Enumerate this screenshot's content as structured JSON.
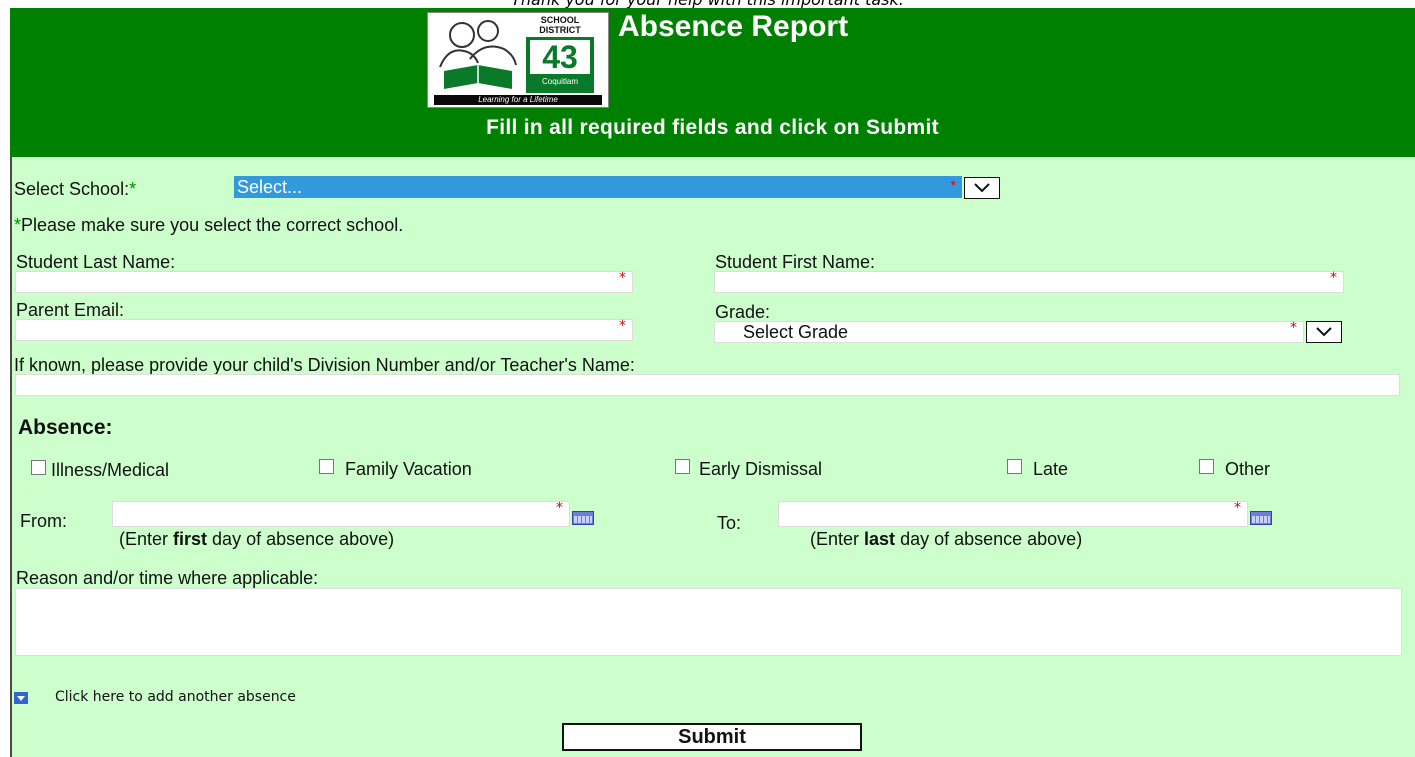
{
  "top_text": "Thank you for your help with this important task.",
  "header": {
    "title": "Absence Report",
    "subtitle": "Fill in all required fields and click on Submit",
    "logo": {
      "school_line1": "SCHOOL",
      "school_line2": "DISTRICT",
      "number": "43",
      "city": "Coquitlam",
      "tagline": "Learning for a Lifetime"
    }
  },
  "form": {
    "select_school_label": "Select School:",
    "required_mark": "*",
    "select_school_value": "Select...",
    "school_note": "Please make sure you select the correct school.",
    "last_name_label": "Student Last Name:",
    "first_name_label": "Student First Name:",
    "parent_email_label": "Parent Email:",
    "grade_label": "Grade:",
    "grade_value": "Select Grade",
    "division_label": "If known, please provide your child's Division Number and/or Teacher's Name:",
    "absence_heading": "Absence:",
    "absence_types": [
      "Illness/Medical",
      "Family Vacation",
      "Early Dismissal",
      "Late",
      "Other"
    ],
    "from_label": "From:",
    "to_label": "To:",
    "from_hint_pre": "(Enter ",
    "from_hint_bold": "first",
    "from_hint_post": " day of absence above)",
    "to_hint_pre": "(Enter ",
    "to_hint_bold": "last",
    "to_hint_post": " day of absence above)",
    "reason_label": "Reason and/or time where applicable:",
    "add_absence_link": "Click here to add another absence",
    "submit_label": "Submit"
  },
  "colors": {
    "header_green": "#008000",
    "form_bg": "#ccffcc",
    "select_highlight": "#3399dd",
    "required_red": "#e00000"
  }
}
